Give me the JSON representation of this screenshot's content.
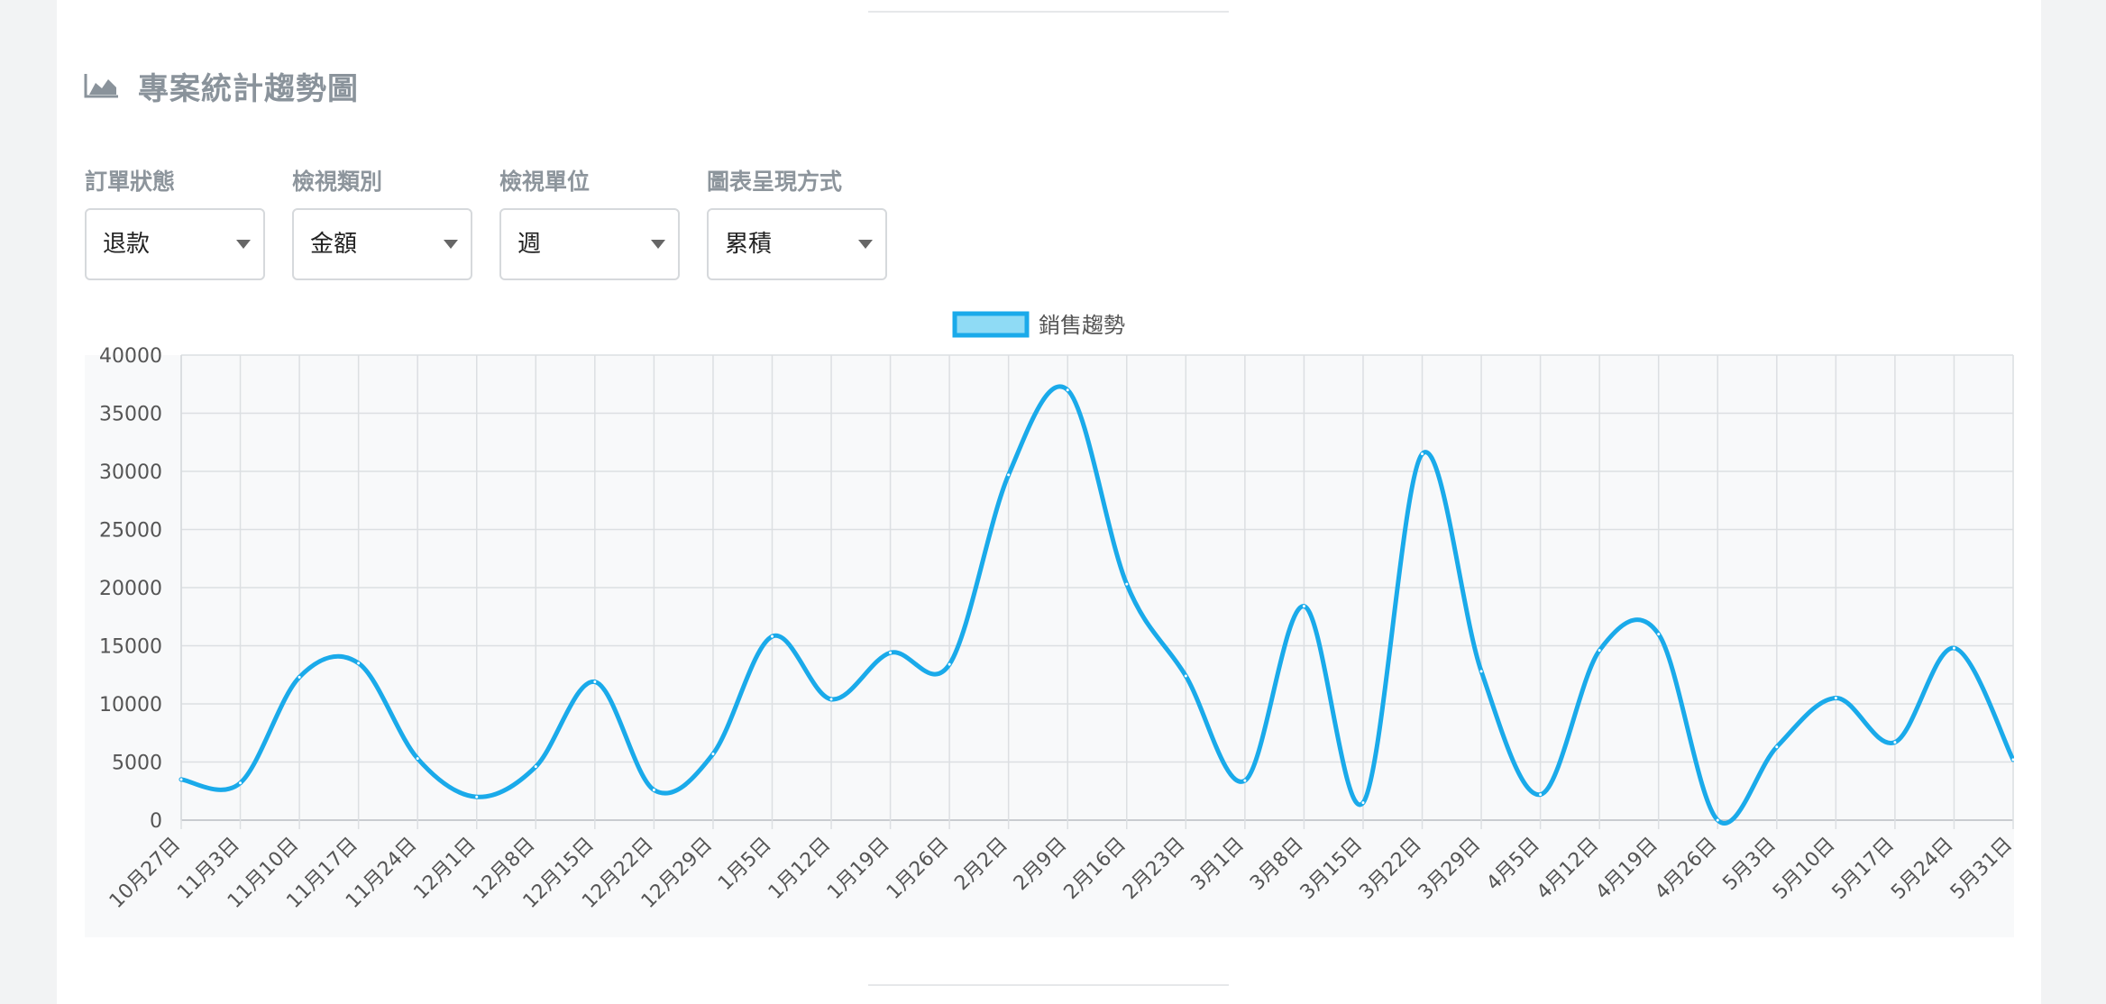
{
  "section": {
    "title": "專案統計趨勢圖",
    "icon": "area-chart-icon"
  },
  "filters": [
    {
      "label": "訂單狀態",
      "value": "退款"
    },
    {
      "label": "檢視類別",
      "value": "金額"
    },
    {
      "label": "檢視單位",
      "value": "週"
    },
    {
      "label": "圖表呈現方式",
      "value": "累積"
    }
  ],
  "colors": {
    "line": "#1aaaea",
    "legend_fill": "#8fdbf5",
    "plot_bg": "#f8f9fa",
    "grid": "#dcdfe2"
  },
  "chart_data": {
    "type": "line",
    "title": "",
    "xlabel": "",
    "ylabel": "",
    "legend": {
      "position": "top-center"
    },
    "grid": true,
    "ylim": [
      0,
      40000
    ],
    "yticks": [
      0,
      5000,
      10000,
      15000,
      20000,
      25000,
      30000,
      35000,
      40000
    ],
    "categories": [
      "10月27日",
      "11月3日",
      "11月10日",
      "11月17日",
      "11月24日",
      "12月1日",
      "12月8日",
      "12月15日",
      "12月22日",
      "12月29日",
      "1月5日",
      "1月12日",
      "1月19日",
      "1月26日",
      "2月2日",
      "2月9日",
      "2月16日",
      "2月23日",
      "3月1日",
      "3月8日",
      "3月15日",
      "3月22日",
      "3月29日",
      "4月5日",
      "4月12日",
      "4月19日",
      "4月26日",
      "5月3日",
      "5月10日",
      "5月17日",
      "5月24日",
      "5月31日"
    ],
    "series": [
      {
        "name": "銷售趨勢",
        "values": [
          3500,
          3200,
          12300,
          13500,
          5300,
          2000,
          4600,
          11900,
          2600,
          5700,
          15800,
          10400,
          14400,
          13400,
          29700,
          37000,
          20300,
          12400,
          3400,
          18400,
          1500,
          31500,
          12800,
          2200,
          14600,
          16000,
          0,
          6300,
          10500,
          6700,
          14800,
          5200
        ]
      }
    ]
  }
}
